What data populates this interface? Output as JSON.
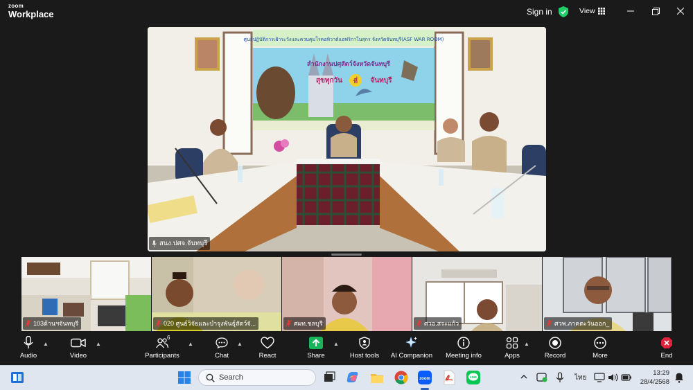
{
  "app": {
    "logo_line1": "zoom",
    "logo_line2": "Workplace"
  },
  "titlebar": {
    "signin_label": "Sign in",
    "view_label": "View",
    "window_controls": [
      "minimize-icon",
      "maximize-icon",
      "close-icon"
    ]
  },
  "main": {
    "speaker_name": "สนง.ปศจ.จันทบุรี",
    "banner_top": "ศูนย์ปฏิบัติการเฝ้าระวังและควบคุมโรคอหิวาต์แอฟริกาในสุกร จังหวัดจันทบุรี(ASF WAR ROOM)",
    "banner_org": "สำนักงานปศุสัตว์จังหวัดจันทบุรี",
    "banner_slogan_a": "สุขทุกวัน",
    "banner_slogan_b": "ที่",
    "banner_slogan_c": "จันทบุรี"
  },
  "gallery": [
    {
      "name": "103ด้านฯจันทบุรี",
      "muted": true
    },
    {
      "name": "020 ศูนย์วิจัยและบำรุงพันธุ์สัตว์จั...",
      "muted": true
    },
    {
      "name": "ศผท.ชลบุรี",
      "muted": true
    },
    {
      "name": "ศวอ.สระแก้ว",
      "muted": true
    },
    {
      "name": "ศวพ.ภาคตะวันออก_",
      "muted": true
    }
  ],
  "controls": {
    "audio": "Audio",
    "video": "Video",
    "participants": "Participants",
    "participants_count": "6",
    "chat": "Chat",
    "react": "React",
    "share": "Share",
    "host_tools": "Host tools",
    "ai_companion": "AI Companion",
    "meeting_info": "Meeting info",
    "apps": "Apps",
    "record": "Record",
    "more": "More",
    "end": "End"
  },
  "taskbar": {
    "search_placeholder": "Search",
    "lang": "ไทย",
    "time": "13:29",
    "date": "28/4/2568"
  },
  "colors": {
    "accent_green": "#1fd06a",
    "share_green": "#17b45a",
    "end_red": "#e0233a",
    "zoom_blue": "#0b5cff"
  }
}
